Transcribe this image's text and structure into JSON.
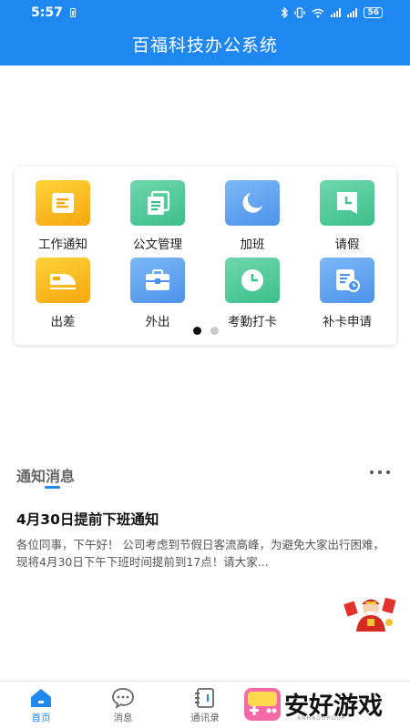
{
  "status_bar": {
    "time": "5:57",
    "battery": "56"
  },
  "header": {
    "title": "百福科技办公系统"
  },
  "grid": {
    "items": [
      {
        "label": "工作通知",
        "icon": "document-icon"
      },
      {
        "label": "公文管理",
        "icon": "files-icon"
      },
      {
        "label": "加班",
        "icon": "moon-icon"
      },
      {
        "label": "请假",
        "icon": "calendar-clock-icon"
      },
      {
        "label": "出差",
        "icon": "train-icon"
      },
      {
        "label": "外出",
        "icon": "briefcase-icon"
      },
      {
        "label": "考勤打卡",
        "icon": "clock-icon"
      },
      {
        "label": "补卡申请",
        "icon": "form-clock-icon"
      }
    ],
    "page_count": 2,
    "active_page": 1
  },
  "notice": {
    "section_title": "通知消息",
    "title": "4月30日提前下班通知",
    "body": "各位同事，下午好！ 公司考虑到节假日客流高峰，为避免大家出行困难，现将4月30日下午下班时间提前到17点！请大家..."
  },
  "tabbar": {
    "tabs": [
      {
        "label": "首页",
        "icon": "home-icon",
        "active": true
      },
      {
        "label": "消息",
        "icon": "chat-icon",
        "active": false
      },
      {
        "label": "通讯录",
        "icon": "contacts-icon",
        "active": false
      }
    ]
  },
  "watermark": {
    "text": "安好游戏",
    "sub": "ANHAOGROUP"
  },
  "colors": {
    "primary": "#1e87f0",
    "orange": "#f7b21e",
    "green": "#4dc996",
    "blue": "#5a9cf0"
  }
}
